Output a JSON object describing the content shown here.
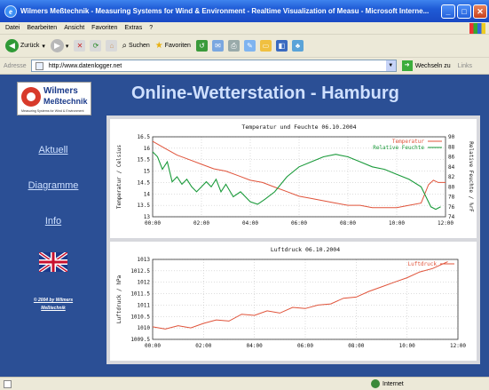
{
  "window": {
    "title": "Wilmers Meßtechnik - Measuring Systems for Wind & Environment - Realtime Visualization of Measu - Microsoft Interne..."
  },
  "menu": [
    "Datei",
    "Bearbeiten",
    "Ansicht",
    "Favoriten",
    "Extras",
    "?"
  ],
  "toolbar": {
    "back": "Zurück",
    "search": "Suchen",
    "favorites": "Favoriten"
  },
  "address": {
    "label": "Adresse",
    "url": "http://www.datenlogger.net",
    "go": "Wechseln zu",
    "links": "Links"
  },
  "site": {
    "logo": {
      "name1": "Wilmers",
      "name2": "Meßtechnik",
      "tagline": "Measuring Systems for Wind & Environment"
    },
    "title": "Online-Wetterstation - Hamburg",
    "nav": [
      "Aktuell",
      "Diagramme",
      "Info"
    ],
    "copyright": [
      "© 2004 by Wilmers",
      "Meßtechnik"
    ]
  },
  "statusbar": {
    "zone": "Internet"
  },
  "chart_data": [
    {
      "type": "line",
      "title": "Temperatur und Feuchte 06.10.2004",
      "ylabel": "Temperatur / Celsius",
      "y2label": "Relative Feuchte / %rF",
      "x_ticks": [
        "00:00",
        "02:00",
        "04:00",
        "06:00",
        "08:00",
        "10:00",
        "12:00"
      ],
      "xlim": [
        0,
        12
      ],
      "ylim": [
        13,
        16.5
      ],
      "y_ticks": [
        "13",
        "13.5",
        "14",
        "14.5",
        "15",
        "15.5",
        "16",
        "16.5"
      ],
      "y2lim": [
        74,
        90
      ],
      "y2_ticks": [
        "74",
        "76",
        "78",
        "80",
        "82",
        "84",
        "86",
        "88",
        "90"
      ],
      "grid": true,
      "legend": "top-right",
      "colors": {
        "temperature": "#e0533a",
        "humidity": "#1a9a3a"
      },
      "series": [
        {
          "name": "Temperatur",
          "axis": "left",
          "x": [
            0,
            0.5,
            1,
            1.5,
            2,
            2.5,
            3,
            3.5,
            4,
            4.5,
            5,
            5.5,
            6,
            6.5,
            7,
            7.5,
            8,
            8.5,
            9,
            9.5,
            10,
            10.5,
            11,
            11.3,
            11.5,
            11.7,
            12
          ],
          "values": [
            16.3,
            16.0,
            15.7,
            15.5,
            15.3,
            15.1,
            15.0,
            14.8,
            14.6,
            14.5,
            14.3,
            14.1,
            13.9,
            13.8,
            13.7,
            13.6,
            13.5,
            13.5,
            13.4,
            13.4,
            13.4,
            13.5,
            13.6,
            14.4,
            14.6,
            14.5,
            14.5
          ]
        },
        {
          "name": "Relative Feuchte",
          "axis": "right",
          "x": [
            0,
            0.2,
            0.4,
            0.6,
            0.8,
            1,
            1.2,
            1.4,
            1.6,
            1.8,
            2,
            2.2,
            2.4,
            2.6,
            2.8,
            3,
            3.3,
            3.6,
            4,
            4.3,
            4.6,
            5,
            5.5,
            6,
            6.5,
            7,
            7.5,
            8,
            8.5,
            9,
            9.5,
            10,
            10.5,
            11,
            11.2,
            11.4,
            11.6,
            11.8
          ],
          "values": [
            87,
            86,
            83.5,
            85,
            81,
            82,
            80.5,
            81.5,
            80,
            79,
            80,
            81,
            80,
            81.5,
            79,
            80.5,
            78,
            79,
            77,
            76.5,
            77.5,
            79,
            82,
            84,
            85,
            86,
            86.5,
            86,
            85,
            84,
            83.5,
            82.5,
            81.5,
            80,
            78,
            76,
            75.5,
            76
          ]
        }
      ]
    },
    {
      "type": "line",
      "title": "Luftdruck 06.10.2004",
      "ylabel": "Luftdruck / hPa",
      "x_ticks": [
        "00:00",
        "02:00",
        "04:00",
        "06:00",
        "08:00",
        "10:00",
        "12:00"
      ],
      "xlim": [
        0,
        12
      ],
      "ylim": [
        1009.5,
        1013
      ],
      "y_ticks": [
        "1009.5",
        "1010",
        "1010.5",
        "1011",
        "1011.5",
        "1012",
        "1012.5",
        "1013"
      ],
      "grid": true,
      "legend": "top-right",
      "colors": {
        "pressure": "#e0533a"
      },
      "series": [
        {
          "name": "Luftdruck",
          "x": [
            0,
            0.5,
            1,
            1.5,
            2,
            2.5,
            3,
            3.5,
            4,
            4.5,
            5,
            5.5,
            6,
            6.5,
            7,
            7.5,
            8,
            8.5,
            9,
            9.5,
            10,
            10.5,
            11,
            11.3,
            11.6
          ],
          "values": [
            1010.05,
            1009.95,
            1010.1,
            1010.0,
            1010.2,
            1010.35,
            1010.3,
            1010.6,
            1010.55,
            1010.75,
            1010.65,
            1010.9,
            1010.85,
            1011.0,
            1011.05,
            1011.3,
            1011.35,
            1011.6,
            1011.8,
            1012.0,
            1012.2,
            1012.45,
            1012.6,
            1012.75,
            1012.9
          ]
        }
      ]
    }
  ]
}
